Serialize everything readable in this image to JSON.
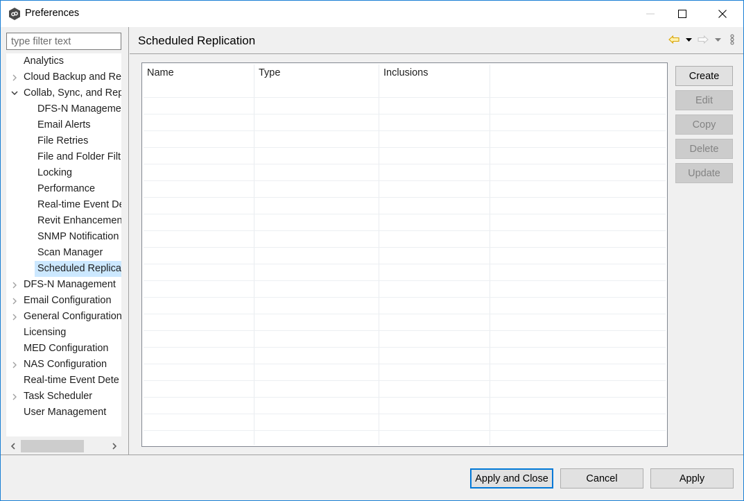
{
  "window": {
    "title": "Preferences",
    "icon": "app-logo-icon",
    "controls": [
      "minimize-icon",
      "maximize-icon",
      "close-icon"
    ]
  },
  "filter": {
    "placeholder": "type filter text",
    "value": ""
  },
  "tree": {
    "items": [
      {
        "label": "Analytics",
        "level": 0,
        "expander": "none"
      },
      {
        "label": "Cloud Backup and Re",
        "level": 0,
        "expander": "collapsed"
      },
      {
        "label": "Collab, Sync, and Rep",
        "level": 0,
        "expander": "expanded"
      },
      {
        "label": "DFS-N Manageme",
        "level": 1,
        "expander": "none"
      },
      {
        "label": "Email Alerts",
        "level": 1,
        "expander": "none"
      },
      {
        "label": "File Retries",
        "level": 1,
        "expander": "none"
      },
      {
        "label": "File and Folder Filt",
        "level": 1,
        "expander": "none"
      },
      {
        "label": "Locking",
        "level": 1,
        "expander": "none"
      },
      {
        "label": "Performance",
        "level": 1,
        "expander": "none"
      },
      {
        "label": "Real-time Event De",
        "level": 1,
        "expander": "none"
      },
      {
        "label": "Revit Enhancemen",
        "level": 1,
        "expander": "none"
      },
      {
        "label": "SNMP Notification",
        "level": 1,
        "expander": "none"
      },
      {
        "label": "Scan Manager",
        "level": 1,
        "expander": "none"
      },
      {
        "label": "Scheduled Replica",
        "level": 1,
        "expander": "none",
        "selected": true
      },
      {
        "label": "DFS-N Management",
        "level": 0,
        "expander": "collapsed"
      },
      {
        "label": "Email Configuration",
        "level": 0,
        "expander": "collapsed"
      },
      {
        "label": "General Configuration",
        "level": 0,
        "expander": "collapsed"
      },
      {
        "label": "Licensing",
        "level": 0,
        "expander": "none"
      },
      {
        "label": "MED Configuration",
        "level": 0,
        "expander": "none"
      },
      {
        "label": "NAS Configuration",
        "level": 0,
        "expander": "collapsed"
      },
      {
        "label": "Real-time Event Dete",
        "level": 0,
        "expander": "none"
      },
      {
        "label": "Task Scheduler",
        "level": 0,
        "expander": "collapsed"
      },
      {
        "label": "User Management",
        "level": 0,
        "expander": "none"
      }
    ],
    "hscroll": {
      "left_arrow": "‹",
      "right_arrow": "›"
    }
  },
  "panel": {
    "title": "Scheduled Replication",
    "nav": {
      "back_icon": "back-arrow-icon",
      "forward_icon": "forward-arrow-icon",
      "menu_icon": "view-menu-icon",
      "back_color": "#e8b400"
    }
  },
  "table": {
    "columns": [
      "Name",
      "Type",
      "Inclusions",
      ""
    ],
    "rows": []
  },
  "side_buttons": [
    {
      "label": "Create",
      "enabled": true
    },
    {
      "label": "Edit",
      "enabled": false
    },
    {
      "label": "Copy",
      "enabled": false
    },
    {
      "label": "Delete",
      "enabled": false
    },
    {
      "label": "Update",
      "enabled": false
    }
  ],
  "footer": {
    "apply_close_label": "Apply and Close",
    "cancel_label": "Cancel",
    "apply_label": "Apply"
  },
  "colors": {
    "selection": "#cce8ff",
    "window_border": "#1a7fd4",
    "default_button_border": "#0078d7"
  }
}
